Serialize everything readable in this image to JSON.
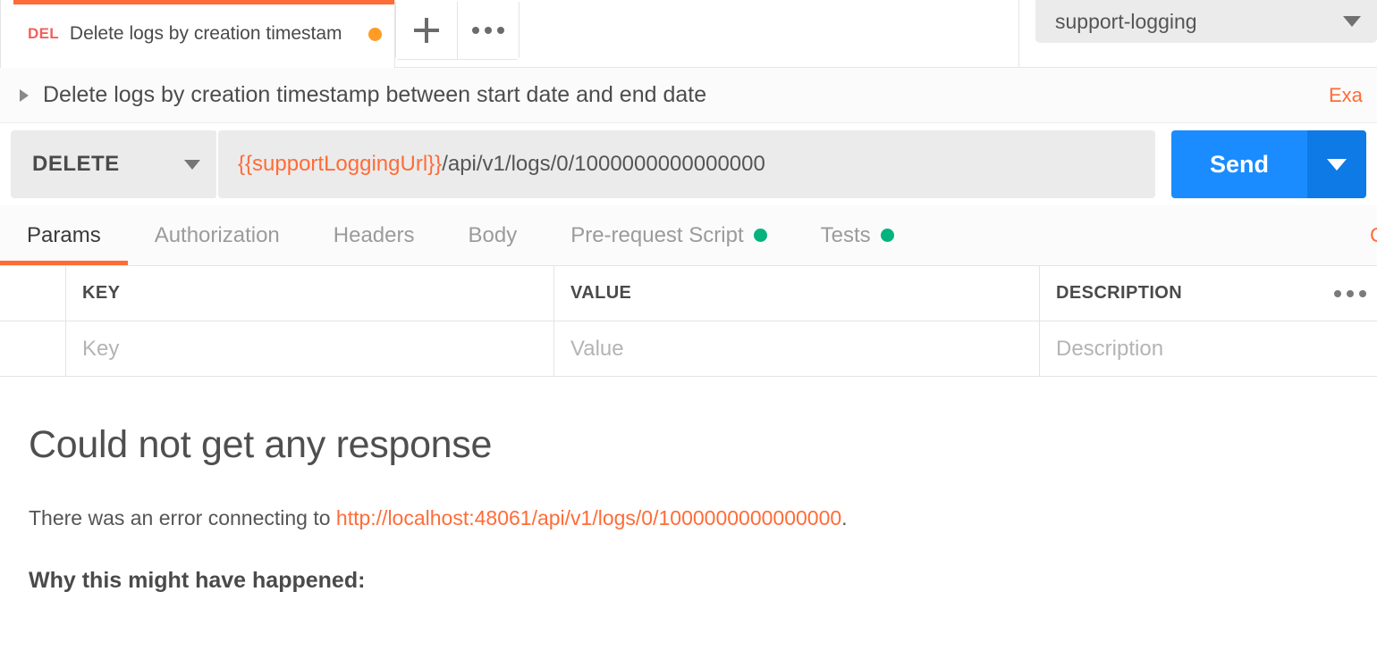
{
  "tabbar": {
    "tabs": [
      {
        "method": "DEL",
        "title": "Delete logs by creation timestam",
        "unsaved": true
      }
    ],
    "new_tab_label": "+",
    "more_label": "•••",
    "plus_icon": "plus-icon",
    "more_icon": "ellipsis-icon"
  },
  "environment": {
    "selected": "support-logging",
    "caret_icon": "chevron-down-icon"
  },
  "request_header": {
    "disclosure_icon": "triangle-right-icon",
    "title": "Delete logs by creation timestamp between start date and end date",
    "examples_label": "Examples"
  },
  "url_bar": {
    "method": "DELETE",
    "method_caret_icon": "chevron-down-icon",
    "url_variable": "{{supportLoggingUrl}}",
    "url_path": "/api/v1/logs/0/1000000000000000",
    "send_label": "Send",
    "send_caret_icon": "chevron-down-icon"
  },
  "request_tabs": {
    "items": [
      {
        "label": "Params",
        "active": true,
        "dot": false
      },
      {
        "label": "Authorization",
        "active": false,
        "dot": false
      },
      {
        "label": "Headers",
        "active": false,
        "dot": false
      },
      {
        "label": "Body",
        "active": false,
        "dot": false
      },
      {
        "label": "Pre-request Script",
        "active": false,
        "dot": true
      },
      {
        "label": "Tests",
        "active": false,
        "dot": true
      }
    ],
    "right_link": "Cookies"
  },
  "params_table": {
    "headers": {
      "key": "KEY",
      "value": "VALUE",
      "description": "DESCRIPTION"
    },
    "bulk_edit_icon": "ellipsis-icon",
    "rows": [
      {
        "key_placeholder": "Key",
        "value_placeholder": "Value",
        "description_placeholder": "Description"
      }
    ]
  },
  "response": {
    "heading": "Could not get any response",
    "message_prefix": "There was an error connecting to ",
    "message_url": "http://localhost:48061/api/v1/logs/0/1000000000000000",
    "message_suffix": ".",
    "why_heading": "Why this might have happened:"
  },
  "colors": {
    "accent_orange": "#ff6c37",
    "send_blue": "#1a8cff",
    "send_blue_dark": "#0e7ae5",
    "method_delete_red": "#f0615c",
    "green_dot": "#06b37e",
    "unsaved_dot": "#ff9c25"
  }
}
